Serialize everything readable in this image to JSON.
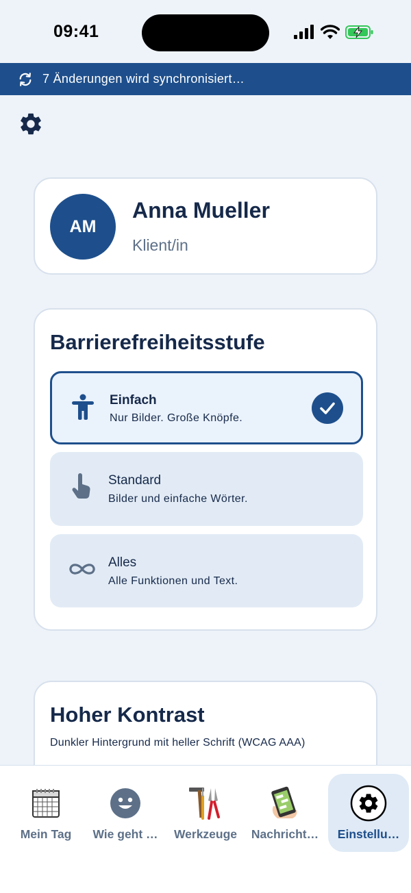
{
  "status_bar": {
    "time": "09:41"
  },
  "sync_banner": {
    "text": "7 Änderungen wird synchronisiert…"
  },
  "profile": {
    "initials": "AM",
    "name": "Anna Mueller",
    "role": "Klient/in"
  },
  "accessibility_level": {
    "title": "Barrierefreiheitsstufe",
    "options": [
      {
        "title": "Einfach",
        "description": "Nur Bilder. Große Knöpfe.",
        "icon": "person-icon",
        "selected": true
      },
      {
        "title": "Standard",
        "description": "Bilder und einfache Wörter.",
        "icon": "touch-icon",
        "selected": false
      },
      {
        "title": "Alles",
        "description": "Alle Funktionen und Text.",
        "icon": "infinity-icon",
        "selected": false
      }
    ]
  },
  "high_contrast": {
    "title": "Hoher Kontrast",
    "description": "Dunkler Hintergrund mit heller Schrift (WCAG AAA)"
  },
  "bottom_nav": {
    "items": [
      {
        "label": "Mein Tag",
        "icon": "calendar-icon",
        "active": false
      },
      {
        "label": "Wie geht …",
        "icon": "smiley-icon",
        "active": false
      },
      {
        "label": "Werkzeuge",
        "icon": "tools-icon",
        "active": false
      },
      {
        "label": "Nachricht…",
        "icon": "phone-message-icon",
        "active": false
      },
      {
        "label": "Einstellu…",
        "icon": "gear-icon",
        "active": true
      }
    ]
  },
  "colors": {
    "primary": "#1e4f8c",
    "background": "#eef3f9",
    "text": "#16294a",
    "muted": "#5d7088",
    "option_bg": "#e2ebf5"
  }
}
